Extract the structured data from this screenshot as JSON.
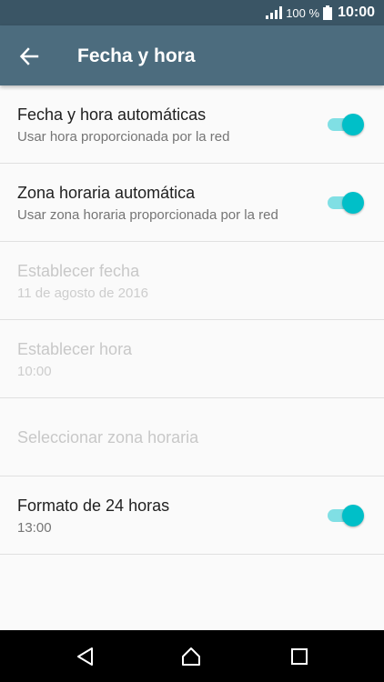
{
  "status_bar": {
    "battery_percent": "100 %",
    "time": "10:00"
  },
  "app_bar": {
    "title": "Fecha y hora",
    "back_icon": "arrow-left-icon"
  },
  "settings": [
    {
      "title": "Fecha y hora automáticas",
      "subtitle": "Usar hora proporcionada por la red",
      "enabled": true,
      "toggle": true
    },
    {
      "title": "Zona horaria automática",
      "subtitle": "Usar zona horaria proporcionada por la red",
      "enabled": true,
      "toggle": true
    },
    {
      "title": "Establecer fecha",
      "subtitle": "11 de agosto de 2016",
      "enabled": false
    },
    {
      "title": "Establecer hora",
      "subtitle": "10:00",
      "enabled": false
    },
    {
      "title": "Seleccionar zona horaria",
      "enabled": false
    },
    {
      "title": "Formato de 24 horas",
      "subtitle": "13:00",
      "enabled": true,
      "toggle": true
    }
  ],
  "colors": {
    "accent": "#00bfc8",
    "app_bar": "#4c6c7e",
    "status_bar": "#3a5565"
  }
}
